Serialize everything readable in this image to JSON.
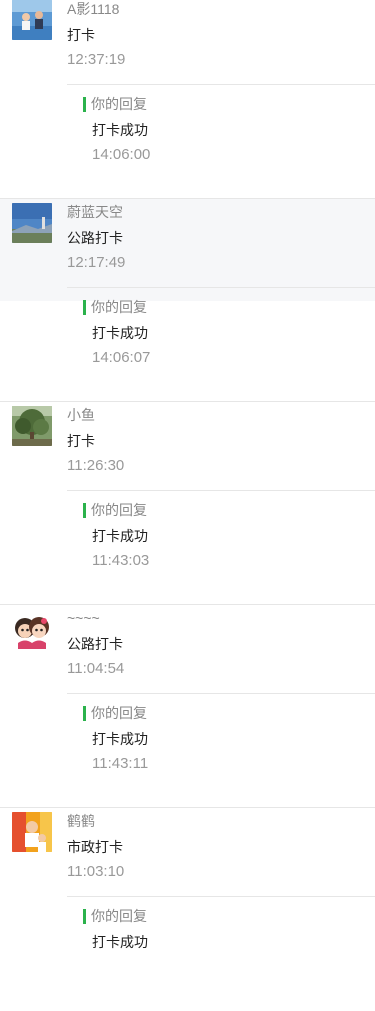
{
  "messages": [
    {
      "avatar_icon": "pool-photo-avatar",
      "name": "A影1118",
      "content": "打卡",
      "time": "12:37:19",
      "reply": {
        "label": "你的回复",
        "text": "打卡成功",
        "time": "14:06:00"
      }
    },
    {
      "avatar_icon": "sky-landscape-avatar",
      "name": "蔚蓝天空",
      "content": "公路打卡",
      "time": "12:17:49",
      "reply": {
        "label": "你的回复",
        "text": "打卡成功",
        "time": "14:06:07"
      }
    },
    {
      "avatar_icon": "tree-photo-avatar",
      "name": "小鱼",
      "content": "打卡",
      "time": "11:26:30",
      "reply": {
        "label": "你的回复",
        "text": "打卡成功",
        "time": "11:43:03"
      }
    },
    {
      "avatar_icon": "cartoon-couple-avatar",
      "name": "~~~~",
      "content": "公路打卡",
      "time": "11:04:54",
      "reply": {
        "label": "你的回复",
        "text": "打卡成功",
        "time": "11:43:11"
      }
    },
    {
      "avatar_icon": "child-photo-avatar",
      "name": "鹤鹤",
      "content": "市政打卡",
      "time": "11:03:10",
      "reply": {
        "label": "你的回复",
        "text": "打卡成功",
        "time": ""
      }
    }
  ],
  "colors": {
    "reply_bar": "#2bb24c",
    "highlight_bg": "#f6f7f9",
    "divider": "#e6e6e6"
  }
}
